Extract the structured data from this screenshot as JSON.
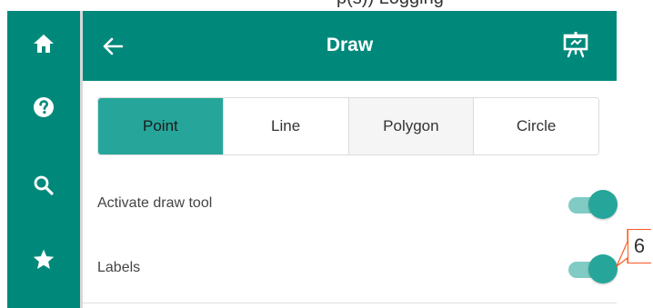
{
  "caption": {
    "text": "p(s)) Logging"
  },
  "rail": {
    "items": [
      {
        "icon": "home-icon"
      },
      {
        "icon": "help-icon"
      },
      {
        "icon": "search-icon"
      },
      {
        "icon": "star-icon"
      }
    ]
  },
  "header": {
    "title": "Draw",
    "back_icon": "arrow-left-icon",
    "right_icon": "presentation-icon"
  },
  "tabs": [
    {
      "label": "Point",
      "active": true
    },
    {
      "label": "Line",
      "active": false
    },
    {
      "label": "Polygon",
      "active": false
    },
    {
      "label": "Circle",
      "active": false
    }
  ],
  "settings": [
    {
      "label": "Activate draw tool",
      "enabled": true
    },
    {
      "label": "Labels",
      "enabled": true
    }
  ],
  "callout": {
    "number": "6"
  },
  "colors": {
    "primary": "#00897b",
    "accent": "#26a69a",
    "toggle_track": "#80cbc4",
    "callout_border": "#ff5a1f"
  }
}
